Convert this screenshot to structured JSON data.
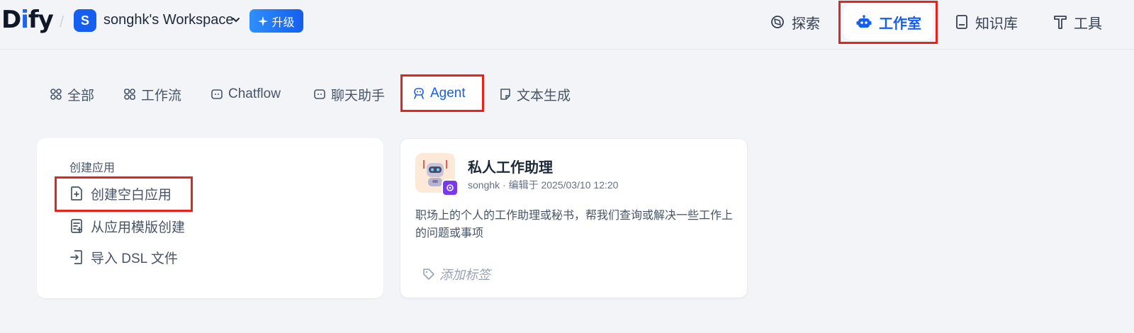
{
  "header": {
    "logo_text": "Dify",
    "workspace_initial": "S",
    "workspace_name": "songhk's Workspace",
    "upgrade_label": "升级",
    "nav": {
      "explore": "探索",
      "studio": "工作室",
      "knowledge": "知识库",
      "tools": "工具"
    },
    "active_nav": "studio"
  },
  "tabs": {
    "all": "全部",
    "workflow": "工作流",
    "chatflow": "Chatflow",
    "chat_assistant": "聊天助手",
    "agent": "Agent",
    "text_generation": "文本生成",
    "active_tab": "agent"
  },
  "create_card": {
    "heading": "创建应用",
    "blank_app": "创建空白应用",
    "from_template": "从应用模版创建",
    "import_dsl": "导入 DSL 文件"
  },
  "app_card": {
    "title": "私人工作助理",
    "meta": "songhk · 编辑于 2025/03/10 12:20",
    "description": "职场上的个人的工作助理或秘书，帮我们查询或解决一些工作上的问题或事项",
    "add_tag": "添加标签"
  },
  "colors": {
    "accent": "#155eef",
    "highlight_box": "#e5241e",
    "background": "#f2f4f7"
  }
}
